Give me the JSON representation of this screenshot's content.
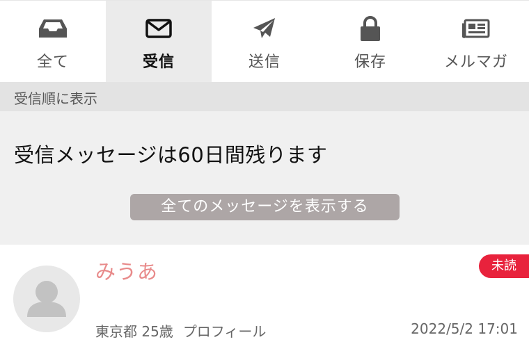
{
  "tabs": [
    {
      "label": "全て",
      "icon": "inbox-tray-icon",
      "active": false
    },
    {
      "label": "受信",
      "icon": "envelope-icon",
      "active": true
    },
    {
      "label": "送信",
      "icon": "paper-plane-icon",
      "active": false
    },
    {
      "label": "保存",
      "icon": "lock-icon",
      "active": false
    },
    {
      "label": "メルマガ",
      "icon": "newspaper-icon",
      "active": false
    }
  ],
  "sort_label": "受信順に表示",
  "notice": {
    "message": "受信メッセージは60日間残ります",
    "show_all_button": "全てのメッセージを表示する"
  },
  "messages": [
    {
      "name": "みうあ",
      "badge": "未読",
      "location_age": "東京都 25歳",
      "profile_link": "プロフィール",
      "date": "2022/5/2 17:01"
    }
  ],
  "colors": {
    "accent_badge": "#e8223c",
    "name_color": "#e88a8a",
    "button_bg": "#ada6a6",
    "active_tab_bg": "#ebebeb"
  }
}
